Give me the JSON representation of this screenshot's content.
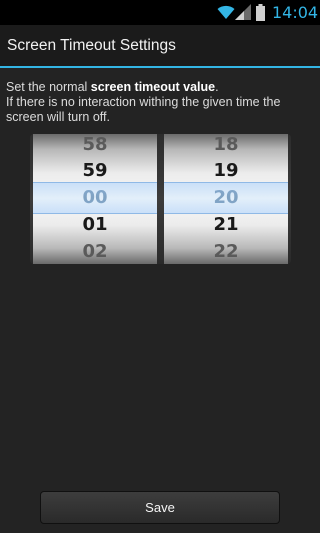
{
  "status_bar": {
    "time": "14:04",
    "icons": [
      "wifi-icon",
      "signal-icon",
      "battery-icon"
    ],
    "accent_color": "#33b5e5"
  },
  "header": {
    "title": "Screen Timeout Settings"
  },
  "description": {
    "prefix": "Set the normal ",
    "bold": "screen timeout value",
    "suffix": ".",
    "line2": "If there is no interaction withing the given time the screen will turn off."
  },
  "picker": {
    "hours": [
      "58",
      "59",
      "00",
      "01",
      "02"
    ],
    "minutes": [
      "18",
      "19",
      "20",
      "21",
      "22"
    ],
    "selected_hours": "00",
    "selected_minutes": "20"
  },
  "actions": {
    "save_label": "Save"
  }
}
